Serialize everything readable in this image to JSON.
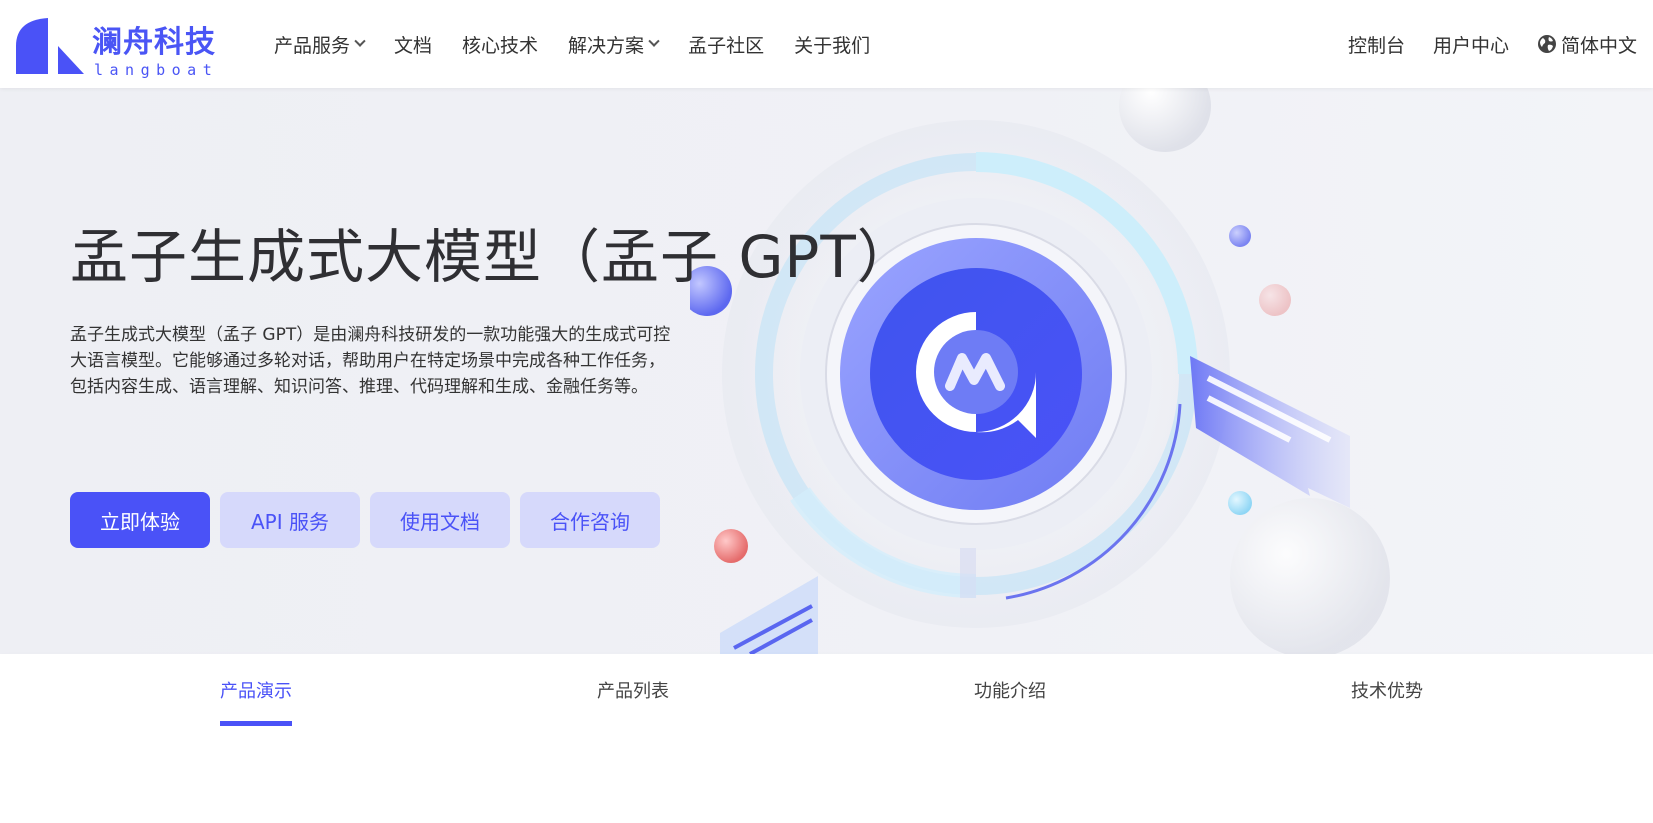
{
  "brand": {
    "name_cn": "澜舟科技",
    "name_en": "langboat",
    "accent": "#4a52f7"
  },
  "nav": {
    "items": [
      {
        "label": "产品服务",
        "dropdown": true
      },
      {
        "label": "文档",
        "dropdown": false
      },
      {
        "label": "核心技术",
        "dropdown": false
      },
      {
        "label": "解决方案",
        "dropdown": true
      },
      {
        "label": "孟子社区",
        "dropdown": false
      },
      {
        "label": "关于我们",
        "dropdown": false
      }
    ],
    "right": {
      "console": "控制台",
      "user_center": "用户中心",
      "language": "简体中文",
      "language_icon": "globe-icon"
    }
  },
  "hero": {
    "title": "孟子生成式大模型（孟子 GPT）",
    "description_lines": [
      "孟子生成式大模型（孟子 GPT）是由澜舟科技研发的一款功能强大的生成式可控",
      "大语言模型。它能够通过多轮对话，帮助用户在特定场景中完成各种工作任务，",
      "包括内容生成、语言理解、知识问答、推理、代码理解和生成、金融任务等。"
    ],
    "buttons": {
      "primary": "立即体验",
      "api": "API 服务",
      "docs": "使用文档",
      "consult": "合作咨询"
    }
  },
  "tabs": {
    "items": [
      "产品演示",
      "产品列表",
      "功能介绍",
      "技术优势"
    ],
    "active_index": 0
  }
}
